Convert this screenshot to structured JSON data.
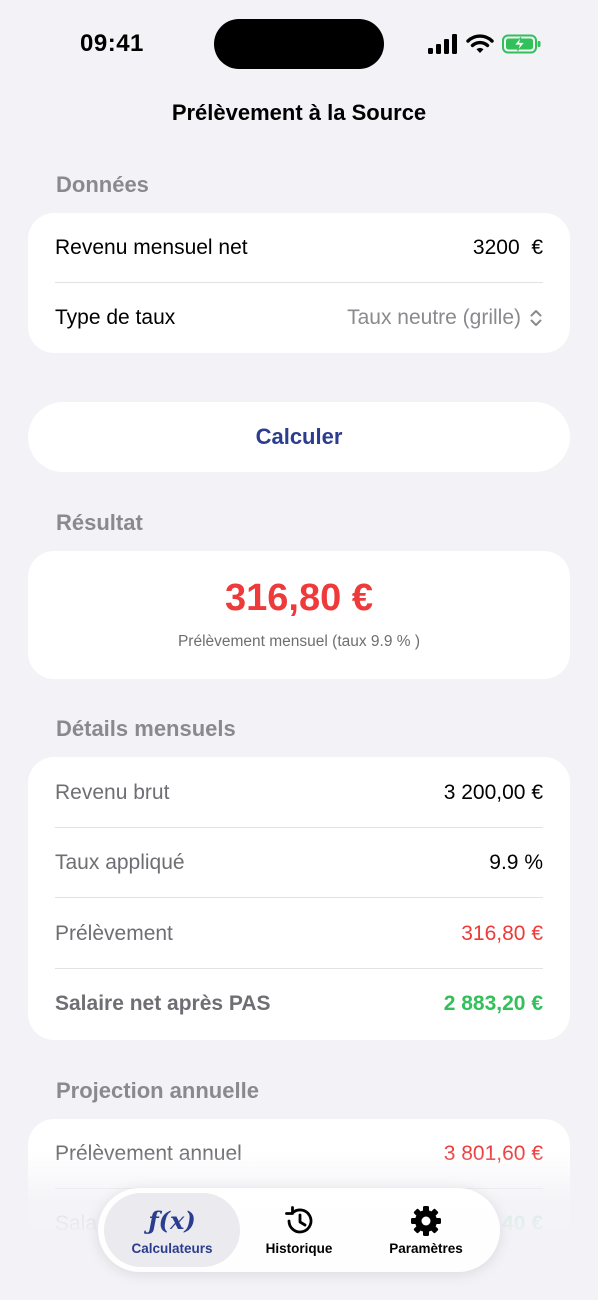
{
  "status_bar": {
    "time": "09:41"
  },
  "nav": {
    "title": "Prélèvement à la Source"
  },
  "inputs": {
    "header": "Données",
    "income_label": "Revenu mensuel net",
    "income_value": "3200",
    "currency": "€",
    "rate_type_label": "Type de taux",
    "rate_type_value": "Taux neutre (grille)"
  },
  "actions": {
    "calculate_label": "Calculer"
  },
  "result": {
    "header": "Résultat",
    "amount": "316,80 €",
    "caption": "Prélèvement mensuel (taux 9.9 % )"
  },
  "monthly": {
    "header": "Détails mensuels",
    "rows": [
      {
        "label": "Revenu brut",
        "value": "3 200,00 €"
      },
      {
        "label": "Taux appliqué",
        "value": "9.9 %"
      },
      {
        "label": "Prélèvement",
        "value": "316,80 €"
      },
      {
        "label": "Salaire net après PAS",
        "value": "2 883,20 €"
      }
    ]
  },
  "annual": {
    "header": "Projection annuelle",
    "rows": [
      {
        "label": "Prélèvement annuel",
        "value": "3 801,60 €"
      },
      {
        "label": "Sala",
        "value": "59",
        "value_tail": "40 €"
      }
    ]
  },
  "tabs": [
    {
      "label": "Calculateurs",
      "icon": "function-icon",
      "active": true
    },
    {
      "label": "Historique",
      "icon": "history-icon",
      "active": false
    },
    {
      "label": "Paramètres",
      "icon": "gear-icon",
      "active": false
    }
  ],
  "colors": {
    "accent": "#2A3D8F",
    "negative": "#EE3A3A",
    "positive": "#32C05A",
    "background": "#F2F2F7"
  }
}
